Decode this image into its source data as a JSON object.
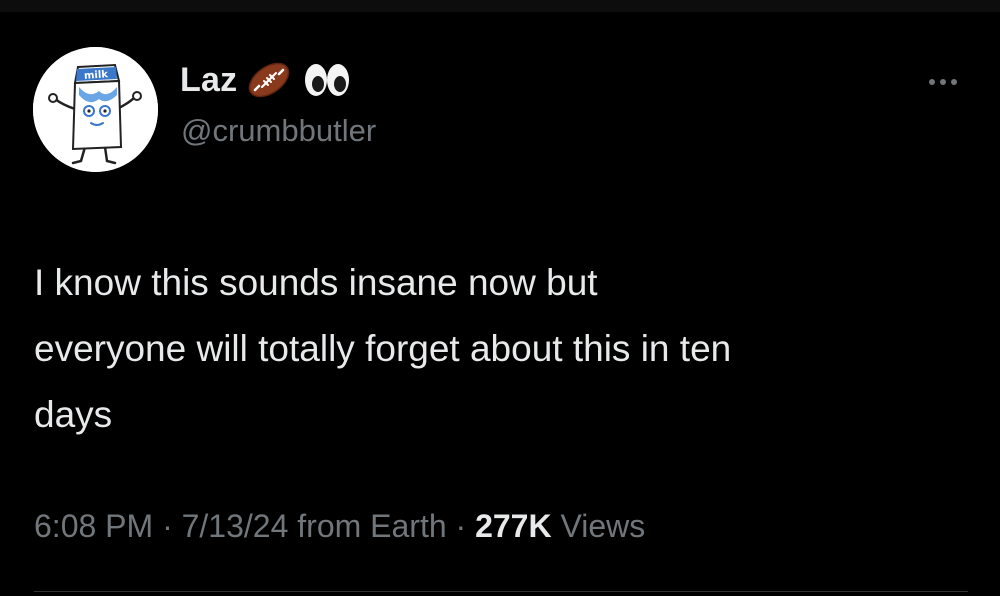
{
  "tweet": {
    "author": {
      "display_name": "Laz",
      "handle": "@crumbbutler",
      "name_emojis": [
        "american-football-icon",
        "eyes-icon"
      ],
      "avatar_text": "milk"
    },
    "text_lines": [
      "I know this sounds insane now but",
      "everyone will totally forget about this in ten",
      "days"
    ],
    "meta": {
      "time": "6:08 PM",
      "separator": "·",
      "date": "7/13/24",
      "source": "from Earth",
      "views_count": "277K",
      "views_label": "Views"
    },
    "colors": {
      "background": "#000000",
      "primary_text": "#e7e9ea",
      "secondary_text": "#71767b",
      "divider": "#2f3336"
    }
  }
}
